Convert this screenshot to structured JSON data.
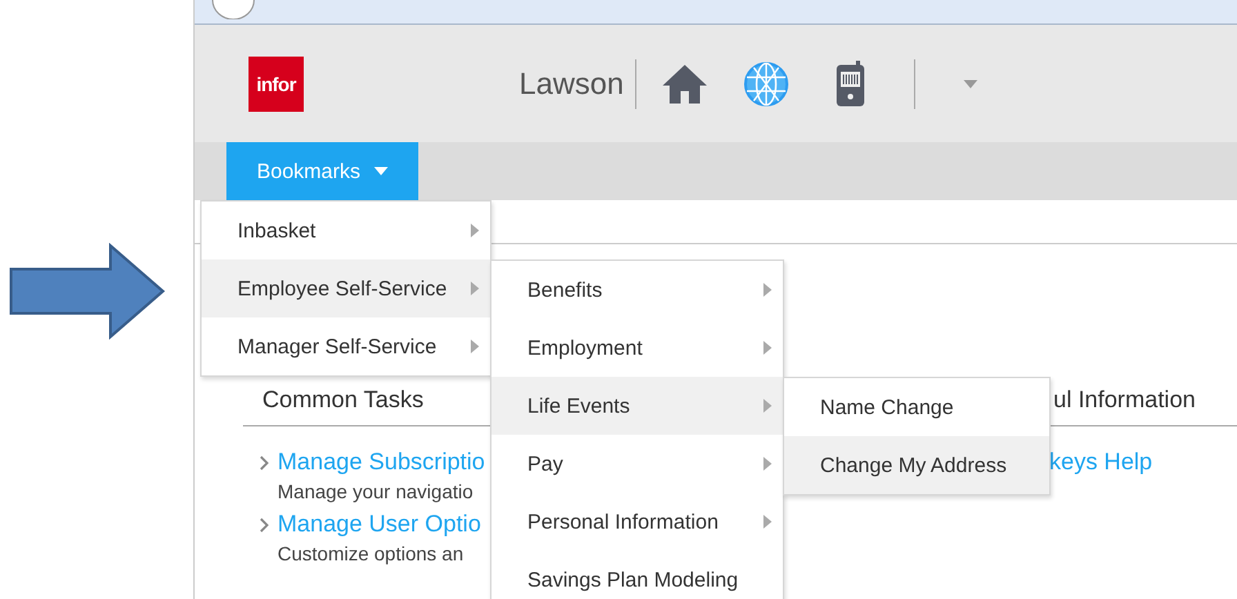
{
  "header": {
    "logo": "infor",
    "app_name": "Lawson"
  },
  "tabs": [
    {
      "label": "Bookmarks",
      "selected": true
    }
  ],
  "menus": [
    {
      "items": [
        {
          "label": "Inbasket",
          "selected": false,
          "submenu": true
        },
        {
          "label": "Employee Self-Service",
          "selected": true,
          "submenu": true
        },
        {
          "label": "Manager Self-Service",
          "selected": false,
          "submenu": true
        }
      ]
    },
    {
      "items": [
        {
          "label": "Benefits",
          "selected": false,
          "submenu": true
        },
        {
          "label": "Employment",
          "selected": false,
          "submenu": true
        },
        {
          "label": "Life Events",
          "selected": true,
          "submenu": true
        },
        {
          "label": "Pay",
          "selected": false,
          "submenu": true
        },
        {
          "label": "Personal Information",
          "selected": false,
          "submenu": true
        },
        {
          "label": "Savings Plan Modeling",
          "selected": false,
          "submenu": false
        }
      ]
    },
    {
      "items": [
        {
          "label": "Name Change",
          "selected": false,
          "submenu": false
        },
        {
          "label": "Change My Address",
          "selected": true,
          "submenu": false
        }
      ]
    }
  ],
  "common_tasks": {
    "title": "Common Tasks",
    "links": [
      {
        "title": "Manage Subscriptio",
        "description": "Manage your navigatio"
      },
      {
        "title": "Manage User Optio",
        "description": "Customize options an"
      }
    ]
  },
  "right_panel": {
    "title": "ul Information",
    "links": [
      "keys Help"
    ]
  }
}
